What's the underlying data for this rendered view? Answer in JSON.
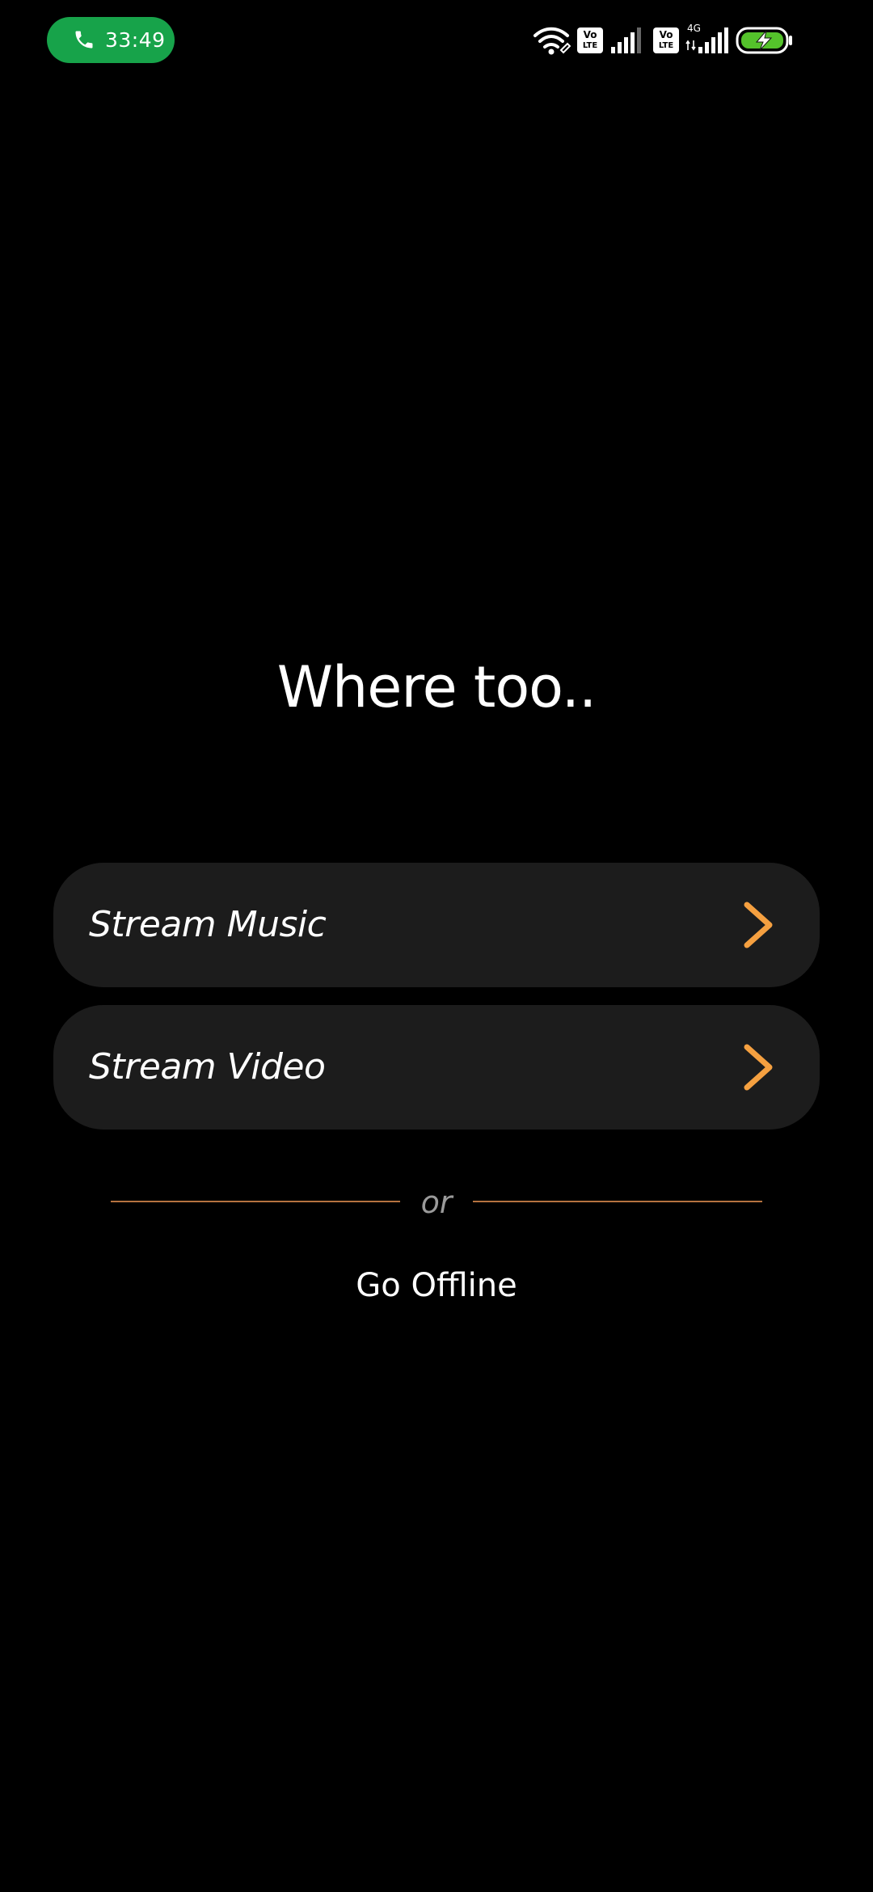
{
  "status_bar": {
    "call_timer": "33:49",
    "call_pill_color": "#17a34a",
    "sim1_badge_top": "Vo",
    "sim1_badge_bottom": "LTE",
    "sim2_badge_top": "Vo",
    "sim2_badge_bottom": "LTE",
    "network_type": "4G",
    "icons": [
      "phone-icon",
      "wifi-icon",
      "volte-icon",
      "signal-icon",
      "volte-icon",
      "signal-icon",
      "battery-charging-icon"
    ]
  },
  "main": {
    "heading": "Where too..",
    "options": [
      {
        "label": "Stream Music",
        "icon": "chevron-right-icon"
      },
      {
        "label": "Stream Video",
        "icon": "chevron-right-icon"
      }
    ],
    "divider_text": "or",
    "offline_label": "Go Offline"
  },
  "colors": {
    "background": "#000000",
    "card": "#1c1c1c",
    "accent": "#f5a040",
    "divider": "#b5723f",
    "muted_text": "#9a9a9a"
  }
}
